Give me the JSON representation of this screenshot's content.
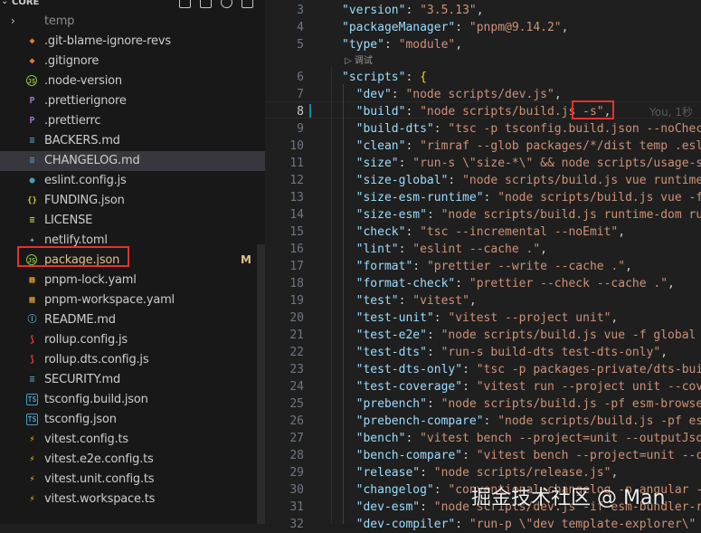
{
  "explorer": {
    "section_title": "CORE",
    "files": [
      {
        "label": "temp",
        "icon": "folder",
        "folder": true,
        "dim": true
      },
      {
        "label": ".git-blame-ignore-revs",
        "icon": "diamond",
        "color": "#e37933"
      },
      {
        "label": ".gitignore",
        "icon": "diamond",
        "color": "#e37933"
      },
      {
        "label": ".node-version",
        "icon": "js-ring",
        "color": "#8dc149"
      },
      {
        "label": ".prettierignore",
        "icon": "p",
        "color": "#a074c4"
      },
      {
        "label": ".prettierrc",
        "icon": "p",
        "color": "#a074c4"
      },
      {
        "label": "BACKERS.md",
        "icon": "lines",
        "color": "#519aba"
      },
      {
        "label": "CHANGELOG.md",
        "icon": "lines",
        "color": "#519aba",
        "selected": true
      },
      {
        "label": "eslint.config.js",
        "icon": "circle",
        "color": "#519aba"
      },
      {
        "label": "FUNDING.json",
        "icon": "braces",
        "color": "#cbcb41"
      },
      {
        "label": "LICENSE",
        "icon": "lines",
        "color": "#cbcb41"
      },
      {
        "label": "netlify.toml",
        "icon": "netlify",
        "color": "#7ab3c7"
      },
      {
        "label": "package.json",
        "icon": "js-ring",
        "color": "#8dc149",
        "badge": "M",
        "badge_color": "#e2c08d",
        "label_color": "#e2c08d"
      },
      {
        "label": "pnpm-lock.yaml",
        "icon": "pnpm",
        "color": "#f0a62a"
      },
      {
        "label": "pnpm-workspace.yaml",
        "icon": "pnpm",
        "color": "#f0a62a"
      },
      {
        "label": "README.md",
        "icon": "info",
        "color": "#519aba"
      },
      {
        "label": "rollup.config.js",
        "icon": "rollup",
        "color": "#e3413b"
      },
      {
        "label": "rollup.dts.config.js",
        "icon": "rollup",
        "color": "#e3413b"
      },
      {
        "label": "SECURITY.md",
        "icon": "lines",
        "color": "#519aba"
      },
      {
        "label": "tsconfig.build.json",
        "icon": "ts",
        "color": "#519aba"
      },
      {
        "label": "tsconfig.json",
        "icon": "ts",
        "color": "#519aba"
      },
      {
        "label": "vitest.config.ts",
        "icon": "vitest",
        "color": "#fcc72b"
      },
      {
        "label": "vitest.e2e.config.ts",
        "icon": "vitest",
        "color": "#fcc72b"
      },
      {
        "label": "vitest.unit.config.ts",
        "icon": "vitest",
        "color": "#fcc72b"
      },
      {
        "label": "vitest.workspace.ts",
        "icon": "vitest",
        "color": "#fcc72b"
      }
    ]
  },
  "editor": {
    "codelens": "调试",
    "ghost_blame": "You, 1秒",
    "lines": [
      {
        "n": "3",
        "tokens": [
          [
            "k",
            "\"version\""
          ],
          [
            "p",
            ": "
          ],
          [
            "s",
            "\"3.5.13\""
          ],
          [
            "p",
            ","
          ]
        ]
      },
      {
        "n": "4",
        "tokens": [
          [
            "k",
            "\"packageManager\""
          ],
          [
            "p",
            ": "
          ],
          [
            "s",
            "\"pnpm@9.14.2\""
          ],
          [
            "p",
            ","
          ]
        ]
      },
      {
        "n": "5",
        "tokens": [
          [
            "k",
            "\"type\""
          ],
          [
            "p",
            ": "
          ],
          [
            "s",
            "\"module\""
          ],
          [
            "p",
            ","
          ]
        ]
      },
      {
        "n": "6",
        "tokens": [
          [
            "k",
            "\"scripts\""
          ],
          [
            "p",
            ": "
          ],
          [
            "b1",
            "{"
          ]
        ]
      },
      {
        "n": "7",
        "tokens": [
          [
            "p",
            "  "
          ],
          [
            "k",
            "\"dev\""
          ],
          [
            "p",
            ": "
          ],
          [
            "s",
            "\"node scripts/dev.js\""
          ],
          [
            "p",
            ","
          ]
        ]
      },
      {
        "n": "8",
        "tokens": [
          [
            "p",
            "  "
          ],
          [
            "k",
            "\"build\""
          ],
          [
            "p",
            ": "
          ],
          [
            "s",
            "\"node scripts/build.js -s\""
          ],
          [
            "p",
            ","
          ]
        ]
      },
      {
        "n": "9",
        "tokens": [
          [
            "p",
            "  "
          ],
          [
            "k",
            "\"build-dts\""
          ],
          [
            "p",
            ": "
          ],
          [
            "s",
            "\"tsc -p tsconfig.build.json --noCheck"
          ]
        ]
      },
      {
        "n": "10",
        "tokens": [
          [
            "p",
            "  "
          ],
          [
            "k",
            "\"clean\""
          ],
          [
            "p",
            ": "
          ],
          [
            "s",
            "\"rimraf --glob packages/*/dist temp .esli"
          ]
        ]
      },
      {
        "n": "11",
        "tokens": [
          [
            "p",
            "  "
          ],
          [
            "k",
            "\"size\""
          ],
          [
            "p",
            ": "
          ],
          [
            "s",
            "\"run-s \\\"size-*\\\" && node scripts/usage-si"
          ]
        ]
      },
      {
        "n": "12",
        "tokens": [
          [
            "p",
            "  "
          ],
          [
            "k",
            "\"size-global\""
          ],
          [
            "p",
            ": "
          ],
          [
            "s",
            "\"node scripts/build.js vue runtime-"
          ]
        ]
      },
      {
        "n": "13",
        "tokens": [
          [
            "p",
            "  "
          ],
          [
            "k",
            "\"size-esm-runtime\""
          ],
          [
            "p",
            ": "
          ],
          [
            "s",
            "\"node scripts/build.js vue -f "
          ]
        ]
      },
      {
        "n": "14",
        "tokens": [
          [
            "p",
            "  "
          ],
          [
            "k",
            "\"size-esm\""
          ],
          [
            "p",
            ": "
          ],
          [
            "s",
            "\"node scripts/build.js runtime-dom run"
          ]
        ]
      },
      {
        "n": "15",
        "tokens": [
          [
            "p",
            "  "
          ],
          [
            "k",
            "\"check\""
          ],
          [
            "p",
            ": "
          ],
          [
            "s",
            "\"tsc --incremental --noEmit\""
          ],
          [
            "p",
            ","
          ]
        ]
      },
      {
        "n": "16",
        "tokens": [
          [
            "p",
            "  "
          ],
          [
            "k",
            "\"lint\""
          ],
          [
            "p",
            ": "
          ],
          [
            "s",
            "\"eslint --cache .\""
          ],
          [
            "p",
            ","
          ]
        ]
      },
      {
        "n": "17",
        "tokens": [
          [
            "p",
            "  "
          ],
          [
            "k",
            "\"format\""
          ],
          [
            "p",
            ": "
          ],
          [
            "s",
            "\"prettier --write --cache .\""
          ],
          [
            "p",
            ","
          ]
        ]
      },
      {
        "n": "18",
        "tokens": [
          [
            "p",
            "  "
          ],
          [
            "k",
            "\"format-check\""
          ],
          [
            "p",
            ": "
          ],
          [
            "s",
            "\"prettier --check --cache .\""
          ],
          [
            "p",
            ","
          ]
        ]
      },
      {
        "n": "19",
        "tokens": [
          [
            "p",
            "  "
          ],
          [
            "k",
            "\"test\""
          ],
          [
            "p",
            ": "
          ],
          [
            "s",
            "\"vitest\""
          ],
          [
            "p",
            ","
          ]
        ]
      },
      {
        "n": "20",
        "tokens": [
          [
            "p",
            "  "
          ],
          [
            "k",
            "\"test-unit\""
          ],
          [
            "p",
            ": "
          ],
          [
            "s",
            "\"vitest --project unit\""
          ],
          [
            "p",
            ","
          ]
        ]
      },
      {
        "n": "21",
        "tokens": [
          [
            "p",
            "  "
          ],
          [
            "k",
            "\"test-e2e\""
          ],
          [
            "p",
            ": "
          ],
          [
            "s",
            "\"node scripts/build.js vue -f global -"
          ]
        ]
      },
      {
        "n": "22",
        "tokens": [
          [
            "p",
            "  "
          ],
          [
            "k",
            "\"test-dts\""
          ],
          [
            "p",
            ": "
          ],
          [
            "s",
            "\"run-s build-dts test-dts-only\""
          ],
          [
            "p",
            ","
          ]
        ]
      },
      {
        "n": "23",
        "tokens": [
          [
            "p",
            "  "
          ],
          [
            "k",
            "\"test-dts-only\""
          ],
          [
            "p",
            ": "
          ],
          [
            "s",
            "\"tsc -p packages-private/dts-buil"
          ]
        ]
      },
      {
        "n": "24",
        "tokens": [
          [
            "p",
            "  "
          ],
          [
            "k",
            "\"test-coverage\""
          ],
          [
            "p",
            ": "
          ],
          [
            "s",
            "\"vitest run --project unit --cove"
          ]
        ]
      },
      {
        "n": "25",
        "tokens": [
          [
            "p",
            "  "
          ],
          [
            "k",
            "\"prebench\""
          ],
          [
            "p",
            ": "
          ],
          [
            "s",
            "\"node scripts/build.js -pf esm-browser"
          ]
        ]
      },
      {
        "n": "26",
        "tokens": [
          [
            "p",
            "  "
          ],
          [
            "k",
            "\"prebench-compare\""
          ],
          [
            "p",
            ": "
          ],
          [
            "s",
            "\"node scripts/build.js -pf esm"
          ]
        ]
      },
      {
        "n": "27",
        "tokens": [
          [
            "p",
            "  "
          ],
          [
            "k",
            "\"bench\""
          ],
          [
            "p",
            ": "
          ],
          [
            "s",
            "\"vitest bench --project=unit --outputJson"
          ]
        ]
      },
      {
        "n": "28",
        "tokens": [
          [
            "p",
            "  "
          ],
          [
            "k",
            "\"bench-compare\""
          ],
          [
            "p",
            ": "
          ],
          [
            "s",
            "\"vitest bench --project=unit --co"
          ]
        ]
      },
      {
        "n": "29",
        "tokens": [
          [
            "p",
            "  "
          ],
          [
            "k",
            "\"release\""
          ],
          [
            "p",
            ": "
          ],
          [
            "s",
            "\"node scripts/release.js\""
          ],
          [
            "p",
            ","
          ]
        ]
      },
      {
        "n": "30",
        "tokens": [
          [
            "p",
            "  "
          ],
          [
            "k",
            "\"changelog\""
          ],
          [
            "p",
            ": "
          ],
          [
            "s",
            "\"conventional-changelog -p angular -i"
          ]
        ]
      },
      {
        "n": "31",
        "tokens": [
          [
            "p",
            "  "
          ],
          [
            "k",
            "\"dev-esm\""
          ],
          [
            "p",
            ": "
          ],
          [
            "s",
            "\"node scripts/dev.js -if esm-bundler-ru"
          ]
        ]
      },
      {
        "n": "32",
        "tokens": [
          [
            "p",
            "  "
          ],
          [
            "k",
            "\"dev-compiler\""
          ],
          [
            "p",
            ": "
          ],
          [
            "s",
            "\"run-p \\\"dev template-explorer\\\" "
          ]
        ]
      }
    ]
  },
  "watermark": "掘金技术社区 @ Man"
}
